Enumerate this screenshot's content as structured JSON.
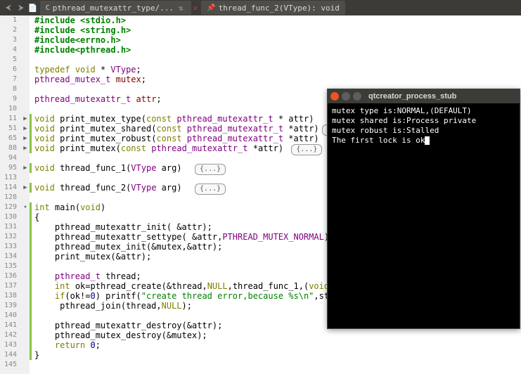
{
  "toolbar": {
    "tab1_label": "pthread_mutexattr_type/...",
    "tab2_pin_icon": "📌",
    "tab2_label": "thread_func_2(VType): void"
  },
  "gutter_lines": [
    "1",
    "2",
    "3",
    "4",
    "5",
    "6",
    "7",
    "8",
    "9",
    "10",
    "11",
    "51",
    "65",
    "88",
    "94",
    "95",
    "113",
    "114",
    "128",
    "129",
    "130",
    "131",
    "132",
    "133",
    "134",
    "135",
    "136",
    "137",
    "138",
    "139",
    "140",
    "141",
    "142",
    "143",
    "144",
    "145"
  ],
  "fold_markers": {
    "10": "▶",
    "11": "▶",
    "12": "▶",
    "13": "▶",
    "15": "▶",
    "17": "▶",
    "19": "▾"
  },
  "change_rows_light": [
    10,
    11,
    12,
    13,
    15,
    17,
    19,
    20,
    21,
    22,
    23,
    24,
    25,
    26,
    27,
    28,
    29,
    30,
    31,
    32,
    33,
    34
  ],
  "change_rows_dark": [],
  "code": {
    "l1": {
      "pre": "#include ",
      "inc": "<stdio.h>"
    },
    "l2": {
      "pre": "#include ",
      "inc": "<string.h>"
    },
    "l3": {
      "pre": "#include",
      "inc": "<errno.h>"
    },
    "l4": {
      "pre": "#include",
      "inc": "<pthread.h>"
    },
    "l6": {
      "kw": "typedef",
      "sp": " ",
      "kw2": "void",
      "sp2": " * ",
      "ty": "VType",
      "end": ";"
    },
    "l7": {
      "ty": "pthread_mutex_t",
      "sp": " ",
      "var": "mutex",
      "end": ";"
    },
    "l9": {
      "ty": "pthread_mutexattr_t",
      "sp": " ",
      "var": "attr",
      "end": ";"
    },
    "l11": {
      "kw": "void",
      "sp": " ",
      "fn": "print_mutex_type",
      "p1": "(",
      "kw2": "const",
      "sp2": " ",
      "ty": "pthread_mutexattr_t",
      "sp3": " * ",
      "arg": "attr",
      "p2": ")  "
    },
    "l12": {
      "kw": "void",
      "sp": " ",
      "fn": "print_mutex_shared",
      "p1": "(",
      "kw2": "const",
      "sp2": " ",
      "ty": "pthread_mutexattr_t",
      "sp3": " *",
      "arg": "attr",
      "p2": ")"
    },
    "l13": {
      "kw": "void",
      "sp": " ",
      "fn": "print_mutex_robust",
      "p1": "(",
      "kw2": "const",
      "sp2": " ",
      "ty": "pthread_mutexattr_t",
      "sp3": " *",
      "arg": "attr",
      "p2": ") "
    },
    "l14": {
      "kw": "void",
      "sp": " ",
      "fn": "print_mutex",
      "p1": "(",
      "kw2": "const",
      "sp2": " ",
      "ty": "pthread_mutexattr_t",
      "sp3": " *",
      "arg": "attr",
      "p2": ") "
    },
    "l16": {
      "kw": "void",
      "sp": " ",
      "fn": "thread_func_1",
      "p1": "(",
      "ty": "VType",
      "sp2": " ",
      "arg": "arg",
      "p2": ")  "
    },
    "l18": {
      "kw": "void",
      "sp": " ",
      "fn": "thread_func_2",
      "p1": "(",
      "ty": "VType",
      "sp2": " ",
      "arg": "arg",
      "p2": ")  "
    },
    "l20": {
      "kw": "int",
      "sp": " ",
      "fn": "main",
      "p1": "(",
      "kw2": "void",
      "p2": ")"
    },
    "l21": "{",
    "l22": {
      "indent": "    ",
      "fn": "pthread_mutexattr_init",
      "args": "( &attr);"
    },
    "l23": {
      "indent": "    ",
      "fn": "pthread_mutexattr_settype",
      "args": "( &attr,",
      "const": "PTHREAD_MUTEX_NORMAL",
      "end": ");"
    },
    "l24": {
      "indent": "    ",
      "fn": "pthread_mutex_init",
      "args": "(&mutex,&attr);"
    },
    "l25": {
      "indent": "    ",
      "fn": "print_mutex",
      "args": "(&attr);"
    },
    "l27": {
      "indent": "    ",
      "ty": "pthread_t",
      "sp": " ",
      "var": "thread",
      "end": ";"
    },
    "l28": {
      "indent": "    ",
      "kw": "int",
      "sp": " ",
      "var": "ok",
      "eq": "=",
      "fn": "pthread_create",
      "args": "(&thread,",
      "null1": "NULL",
      "c1": ",thread_func_1,(",
      "kw2": "void",
      "end": "*"
    },
    "l29": {
      "indent": "    ",
      "kw": "if",
      "cond": "(ok!=",
      "num": "0",
      "p": ") ",
      "fn": "printf",
      "p1": "(",
      "str": "\"create thread error,because %s\\n\"",
      "end": ",st"
    },
    "l30": {
      "indent": "     ",
      "fn": "pthread_join",
      "args": "(thread,",
      "null": "NULL",
      "end": ");"
    },
    "l32": {
      "indent": "    ",
      "fn": "pthread_mutexattr_destroy",
      "args": "(&attr);"
    },
    "l33": {
      "indent": "    ",
      "fn": "pthread_mutex_destroy",
      "args": "(&mutex);"
    },
    "l34": {
      "indent": "    ",
      "kw": "return",
      "sp": " ",
      "num": "0",
      "end": ";"
    },
    "l35": "}"
  },
  "fold_label": "{...}",
  "terminal": {
    "title": "qtcreator_process_stub",
    "lines": [
      "mutex type is:NORMAL,(DEFAULT)",
      "mutex shared is:Process private",
      "mutex robust is:Stalled",
      "The first lock is ok"
    ]
  }
}
